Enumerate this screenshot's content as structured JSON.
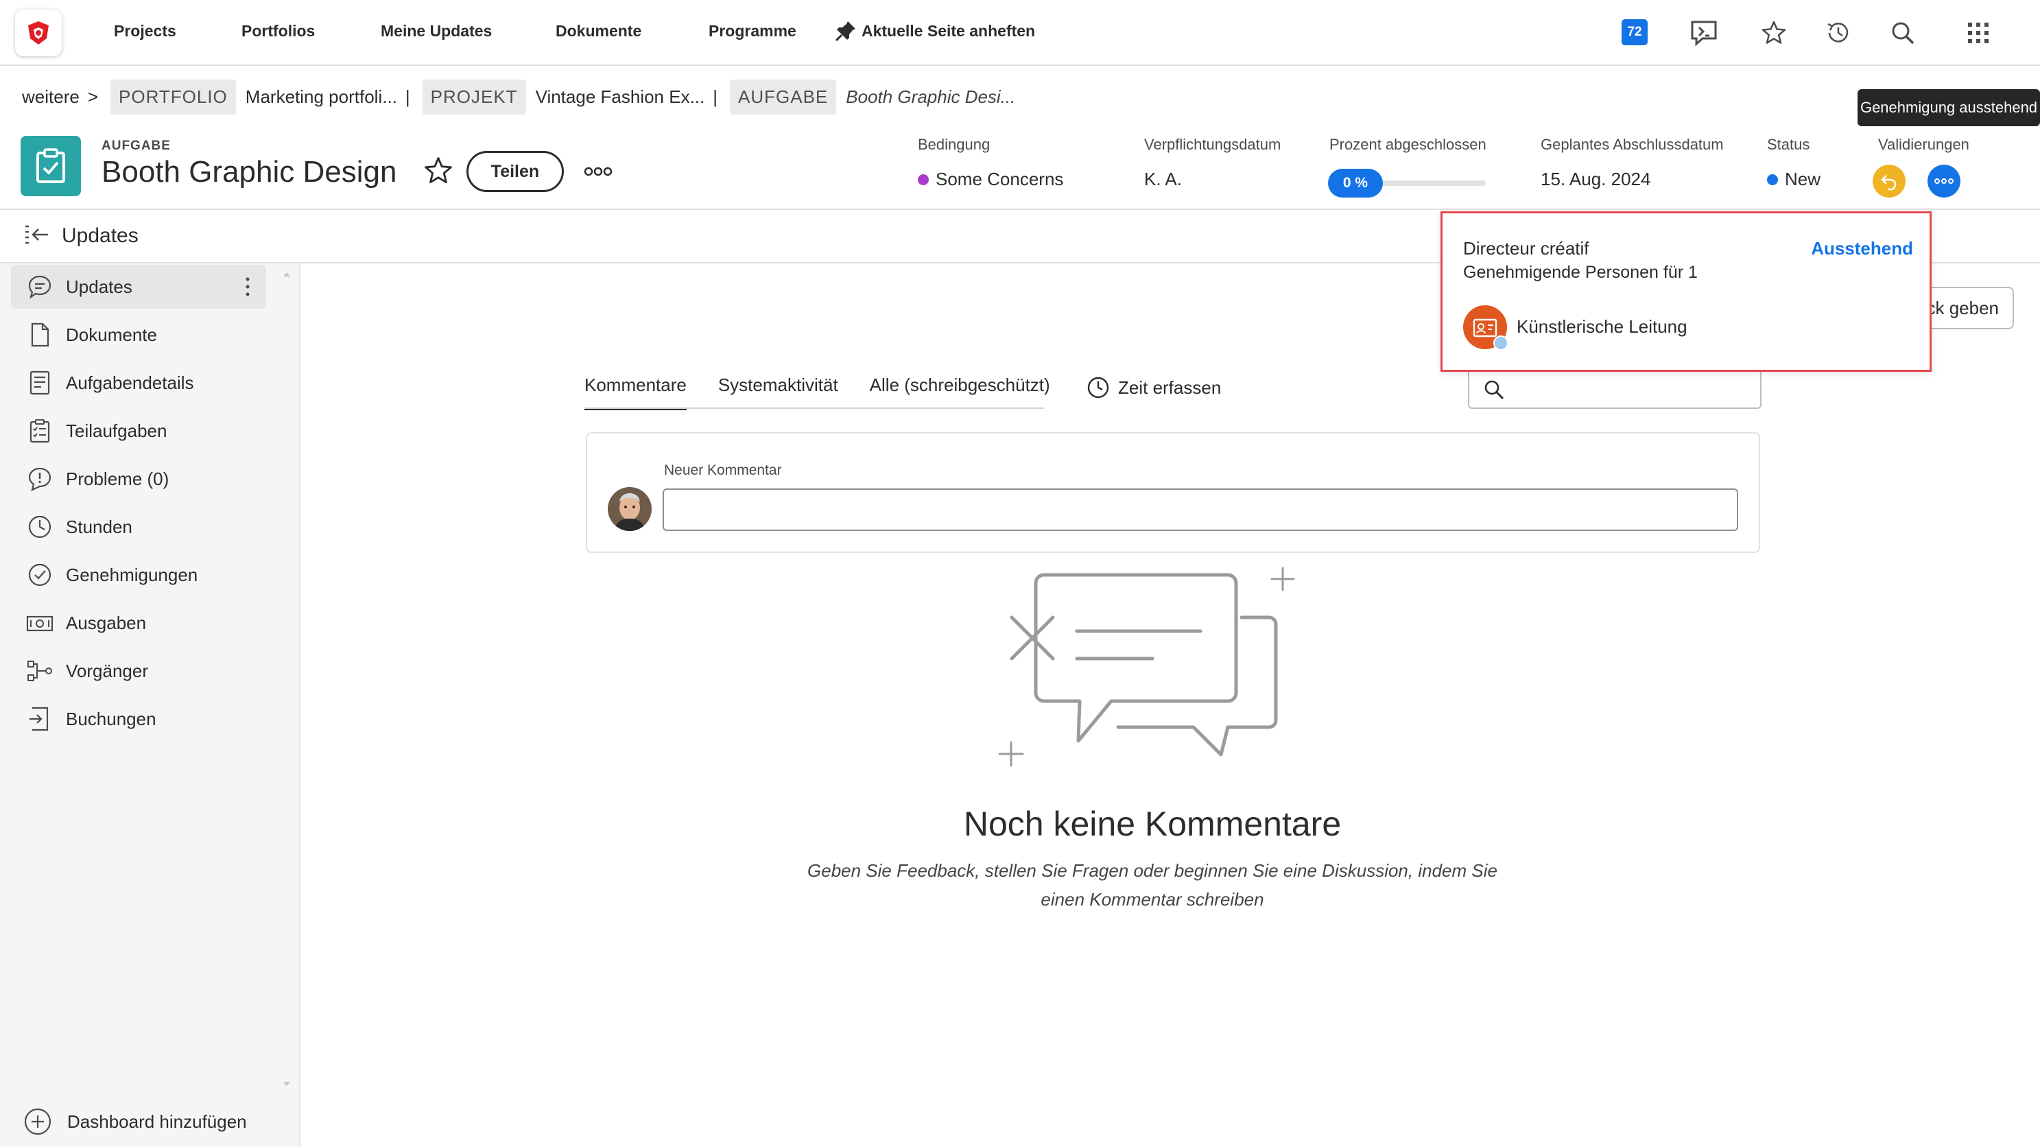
{
  "nav": {
    "items": [
      "Projects",
      "Portfolios",
      "Meine Updates",
      "Dokumente",
      "Programme"
    ],
    "pin_label": "Aktuelle Seite anheften",
    "badge_count": "72",
    "icons": [
      "notifications-icon",
      "favorites-icon",
      "recents-icon",
      "search-icon",
      "apps-grid-icon"
    ]
  },
  "breadcrumb": {
    "more": "weitere",
    "chevron": ">",
    "portfolio_chip": "PORTFOLIO",
    "portfolio_name": "Marketing portfoli...",
    "sep1": "|",
    "project_chip": "PROJEKT",
    "project_name": "Vintage Fashion Ex...",
    "sep2": "|",
    "task_chip": "AUFGABE",
    "task_name": "Booth Graphic Desi..."
  },
  "tooltip": "Genehmigung ausstehend",
  "header": {
    "type": "AUFGABE",
    "title": "Booth Graphic Design",
    "share_label": "Teilen",
    "fields": {
      "condition_label": "Bedingung",
      "condition_value": "Some Concerns",
      "commit_label": "Verpflichtungsdatum",
      "commit_value": "K. A.",
      "percent_label": "Prozent abgeschlossen",
      "percent_value": "0 %",
      "planned_label": "Geplantes Abschlussdatum",
      "planned_value": "15. Aug. 2024",
      "status_label": "Status",
      "status_value": "New",
      "validations_label": "Validierungen"
    },
    "colors": {
      "condition": "#a83ec9",
      "status": "#1473e6",
      "approval_pending": "#f0b323",
      "approval_more": "#1473e6"
    }
  },
  "panel": {
    "title": "Updates",
    "items": [
      {
        "label": "Updates",
        "icon": "comment-icon",
        "active": true
      },
      {
        "label": "Dokumente",
        "icon": "document-icon"
      },
      {
        "label": "Aufgabendetails",
        "icon": "details-icon"
      },
      {
        "label": "Teilaufgaben",
        "icon": "subtasks-icon"
      },
      {
        "label": "Probleme (0)",
        "icon": "issue-icon"
      },
      {
        "label": "Stunden",
        "icon": "clock-icon"
      },
      {
        "label": "Genehmigungen",
        "icon": "approval-icon"
      },
      {
        "label": "Ausgaben",
        "icon": "money-icon"
      },
      {
        "label": "Vorgänger",
        "icon": "predecessor-icon"
      },
      {
        "label": "Buchungen",
        "icon": "booking-icon"
      }
    ],
    "add_dashboard": "Dashboard hinzufügen"
  },
  "main": {
    "tabs": [
      "Kommentare",
      "Systemaktivität",
      "Alle (schreibgeschützt)"
    ],
    "time_log": "Zeit erfassen",
    "feedback_button": "ck geben",
    "new_comment_label": "Neuer Kommentar",
    "empty_title": "Noch keine Kommentare",
    "empty_subtitle": "Geben Sie Feedback, stellen Sie Fragen oder beginnen Sie eine Diskussion, indem Sie einen Kommentar schreiben"
  },
  "approval_popover": {
    "title": "Directeur créatif",
    "status": "Ausstehend",
    "subtitle": "Genehmigende Personen für 1",
    "approver": "Künstlerische Leitung"
  }
}
